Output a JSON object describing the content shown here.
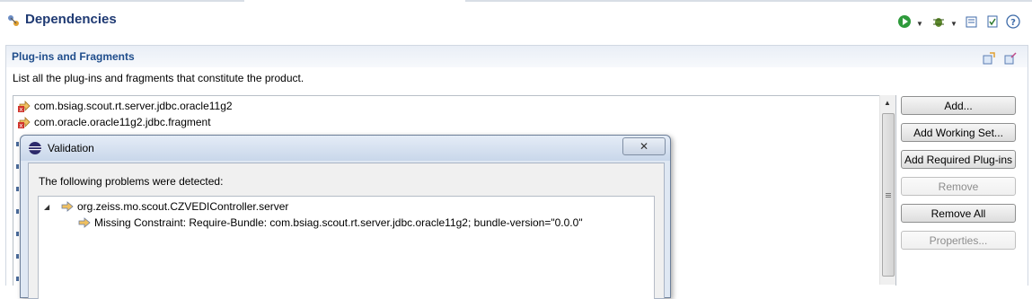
{
  "header": {
    "title": "Dependencies"
  },
  "toolbar": {
    "icons": [
      "run-icon",
      "debug-icon",
      "export-icon",
      "validate-icon",
      "help-icon"
    ]
  },
  "section": {
    "title": "Plug-ins and Fragments",
    "description": "List all the plug-ins and fragments that constitute the product."
  },
  "list": {
    "items": [
      {
        "label": "com.bsiag.scout.rt.server.jdbc.oracle11g2",
        "icon": "plugin-error-icon"
      },
      {
        "label": "com.oracle.oracle11g2.jdbc.fragment",
        "icon": "fragment-error-icon"
      }
    ]
  },
  "buttons": {
    "add": "Add...",
    "add_working_set": "Add Working Set...",
    "add_required": "Add Required Plug-ins",
    "remove": "Remove",
    "remove_all": "Remove All",
    "properties": "Properties..."
  },
  "dialog": {
    "title": "Validation",
    "message": "The following problems were detected:",
    "tree": {
      "root": "org.zeiss.mo.scout.CZVEDIController.server",
      "child": "Missing Constraint: Require-Bundle: com.bsiag.scout.rt.server.jdbc.oracle11g2; bundle-version=\"0.0.0\""
    }
  },
  "colors": {
    "title": "#1f3a73",
    "section_title": "#1f4d8c",
    "error": "#d0342c"
  }
}
